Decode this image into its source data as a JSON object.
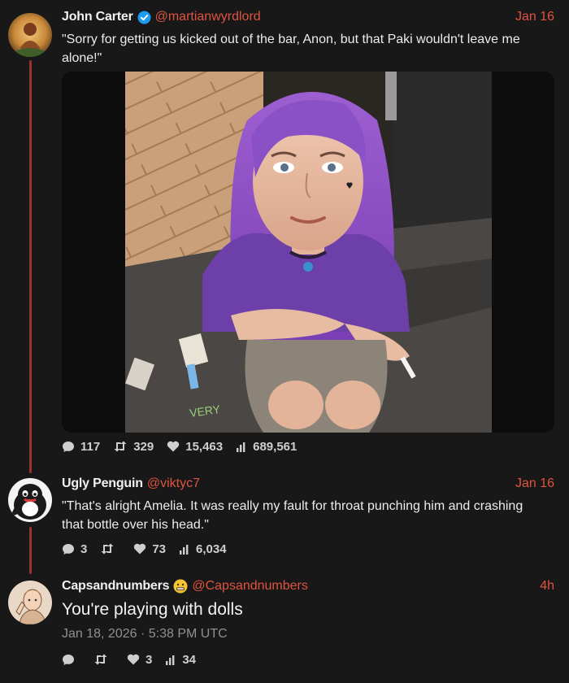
{
  "tweets": [
    {
      "name": "John Carter",
      "handle": "@martianwyrdlord",
      "date": "Jan 16",
      "text": "\"Sorry for getting us kicked out of the bar, Anon, but that Paki wouldn't leave me alone!\"",
      "stats": {
        "replies": "117",
        "retweets": "329",
        "likes": "15,463",
        "views": "689,561"
      }
    },
    {
      "name": "Ugly Penguin",
      "handle": "@viktyc7",
      "date": "Jan 16",
      "text": "\"That's alright Amelia. It was really my fault for throat punching him and crashing that bottle over his head.\"",
      "stats": {
        "replies": "3",
        "retweets": "",
        "likes": "73",
        "views": "6,034"
      }
    },
    {
      "name": "Capsandnumbers",
      "handle": "@Capsandnumbers",
      "date": "4h",
      "text": "You're playing with dolls",
      "timestamp": "Jan 18, 2026 · 5:38 PM UTC",
      "stats": {
        "replies": "",
        "retweets": "",
        "likes": "3",
        "views": "34"
      }
    }
  ],
  "colors": {
    "accent": "#e0533f",
    "thread_line": "#9e3232",
    "background": "#181818"
  },
  "icons": [
    "verified-badge-icon",
    "grimace-emoji-icon",
    "reply-icon",
    "retweet-icon",
    "like-icon",
    "views-icon"
  ]
}
